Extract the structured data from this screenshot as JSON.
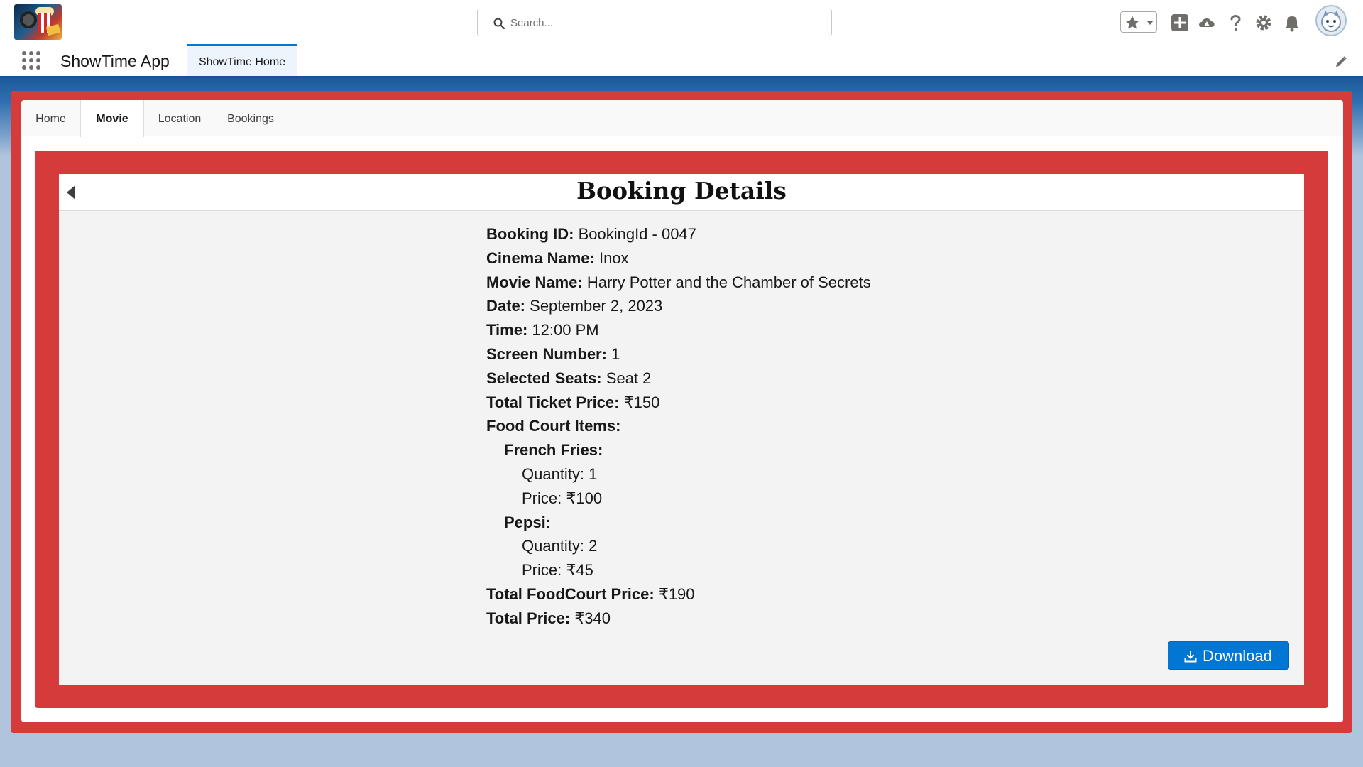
{
  "global_header": {
    "search": {
      "placeholder": "Search...",
      "value": ""
    }
  },
  "app_nav": {
    "app_name": "ShowTime App",
    "tabs": [
      {
        "label": "ShowTime Home",
        "active": true
      }
    ]
  },
  "page_tabs": [
    {
      "label": "Home",
      "active": false
    },
    {
      "label": "Movie",
      "active": true
    },
    {
      "label": "Location",
      "active": false
    },
    {
      "label": "Bookings",
      "active": false
    }
  ],
  "booking": {
    "title": "Booking Details",
    "booking_id": {
      "label": "Booking ID:",
      "value": "BookingId - 0047"
    },
    "cinema_name": {
      "label": "Cinema Name:",
      "value": "Inox"
    },
    "movie_name": {
      "label": "Movie Name:",
      "value": "Harry Potter and the Chamber of Secrets"
    },
    "date": {
      "label": "Date:",
      "value": "September 2, 2023"
    },
    "time": {
      "label": "Time:",
      "value": "12:00 PM"
    },
    "screen_number": {
      "label": "Screen Number:",
      "value": "1"
    },
    "selected_seats": {
      "label": "Selected Seats:",
      "value": "Seat 2"
    },
    "total_ticket_price": {
      "label": "Total Ticket Price:",
      "value": "₹150"
    },
    "food_court_label": "Food Court Items:",
    "food_items": [
      {
        "name": "French Fries:",
        "quantity": "Quantity: 1",
        "price": "Price: ₹100"
      },
      {
        "name": "Pepsi:",
        "quantity": "Quantity: 2",
        "price": "Price: ₹45"
      }
    ],
    "total_foodcourt_price": {
      "label": "Total FoodCourt Price:",
      "value": "₹190"
    },
    "total_price": {
      "label": "Total Price:",
      "value": "₹340"
    },
    "download_label": "Download"
  },
  "colors": {
    "frame_red": "#d63b3b",
    "brand_blue": "#0176d3",
    "nav_underline": "#1b5297",
    "page_background": "#b0c4de"
  },
  "icons": [
    "search-icon",
    "favorites-star-icon",
    "chevron-down-icon",
    "add-icon",
    "trailhead-icon",
    "help-icon",
    "gear-icon",
    "bell-icon",
    "avatar",
    "app-launcher-icon",
    "edit-pencil-icon",
    "back-arrow-icon",
    "download-icon"
  ]
}
